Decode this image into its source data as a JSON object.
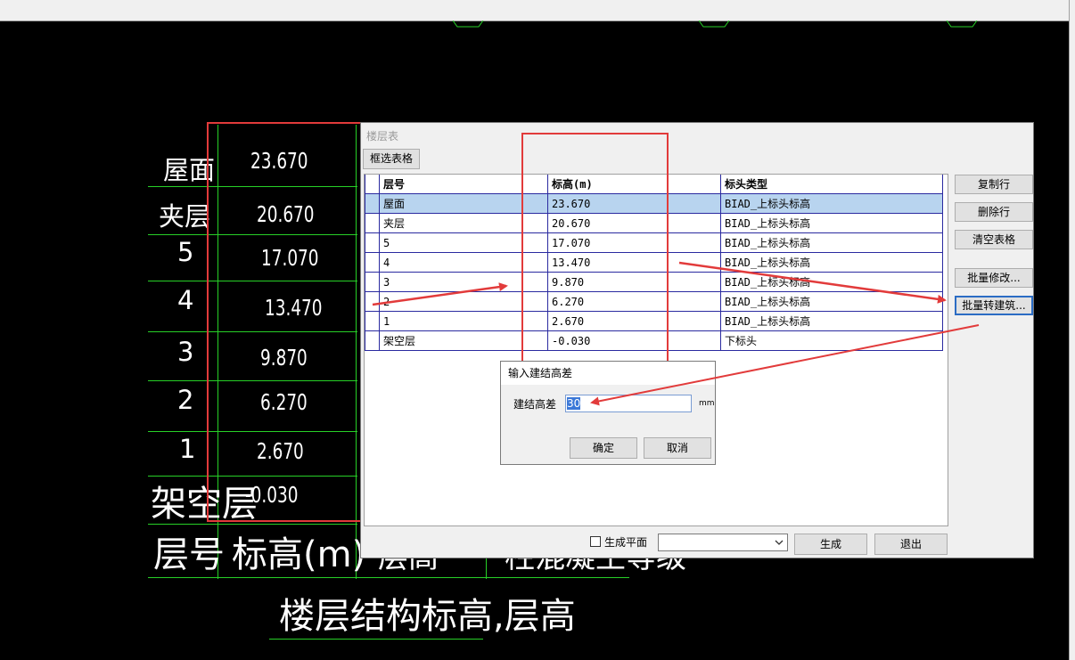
{
  "cad": {
    "rows": [
      {
        "label": "屋面",
        "value": "23.670"
      },
      {
        "label": "夹层",
        "value": "20.670"
      },
      {
        "label": "5",
        "value": "17.070"
      },
      {
        "label": "4",
        "value": "13.470"
      },
      {
        "label": "3",
        "value": "9.870"
      },
      {
        "label": "2",
        "value": "6.270"
      },
      {
        "label": "1",
        "value": "2.670"
      },
      {
        "label": "架空层",
        "value": "-0.030"
      }
    ],
    "header_floor": "层号",
    "header_elev": "标高(m)",
    "header_partial1": "层高",
    "header_partial2": "柱混凝土等级",
    "caption": "楼层结构标高,层高"
  },
  "dialog": {
    "title": "楼层表",
    "select_button": "框选表格",
    "columns": [
      "层号",
      "标高(m)",
      "标头类型"
    ],
    "rows": [
      [
        "屋面",
        "23.670",
        "BIAD_上标头标高"
      ],
      [
        "夹层",
        "20.670",
        "BIAD_上标头标高"
      ],
      [
        "5",
        "17.070",
        "BIAD_上标头标高"
      ],
      [
        "4",
        "13.470",
        "BIAD_上标头标高"
      ],
      [
        "3",
        "9.870",
        "BIAD_上标头标高"
      ],
      [
        "2",
        "6.270",
        "BIAD_上标头标高"
      ],
      [
        "1",
        "2.670",
        "BIAD_上标头标高"
      ],
      [
        "架空层",
        "-0.030",
        "下标头"
      ]
    ],
    "side_buttons": {
      "copy_row": "复制行",
      "delete_row": "删除行",
      "clear_table": "清空表格",
      "batch_modify": "批量修改...",
      "batch_convert": "批量转建筑..."
    },
    "generate_plan_label": "生成平面",
    "generate_button": "生成",
    "exit_button": "退出"
  },
  "subdialog": {
    "title": "输入建结高差",
    "field_label": "建结高差",
    "field_value": "30",
    "unit": "mm",
    "ok": "确定",
    "cancel": "取消"
  },
  "colors": {
    "annotation_red": "#e23b3b",
    "cad_green": "#27d027",
    "selection": "#b8d4ef"
  }
}
